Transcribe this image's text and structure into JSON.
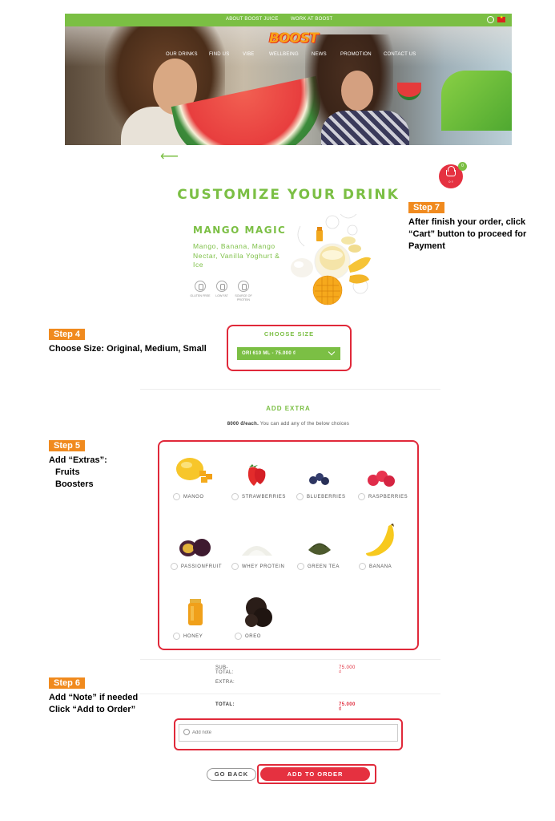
{
  "topbar": {
    "about": "ABOUT BOOST JUICE",
    "work": "WORK AT BOOST"
  },
  "logo": "BOOST",
  "nav": [
    "OUR DRINKS",
    "FIND US",
    "VIBE",
    "WELLBEING",
    "NEWS",
    "PROMOTION",
    "CONTACT US"
  ],
  "back_arrow": "⟵",
  "cart": {
    "count": "0",
    "amount": "0 ₫"
  },
  "page_title": "CUSTOMIZE YOUR DRINK",
  "product": {
    "name": "MANGO MAGIC",
    "description": "Mango, Banana, Mango Nectar, Vanilla Yoghurt & Ice",
    "badges": [
      {
        "label": "GLUTEN FREE",
        "icon": "gluten-free-icon"
      },
      {
        "label": "LOW FAT",
        "icon": "low-fat-icon"
      },
      {
        "label": "SOURCE OF PROTEIN",
        "icon": "protein-icon"
      }
    ]
  },
  "size": {
    "label": "CHOOSE SIZE",
    "selected": "ORI 610 ML - 75.000 ₫"
  },
  "extra": {
    "title": "ADD EXTRA",
    "price_bold": "8000 đ/each.",
    "price_rest": " You can add any of the below choices",
    "items": [
      {
        "label": "MANGO",
        "icon": "mango-icon"
      },
      {
        "label": "STRAWBERRIES",
        "icon": "strawberry-icon"
      },
      {
        "label": "BLUEBERRIES",
        "icon": "blueberry-icon"
      },
      {
        "label": "RASPBERRIES",
        "icon": "raspberry-icon"
      },
      {
        "label": "PASSIONFRUIT",
        "icon": "passionfruit-icon"
      },
      {
        "label": "WHEY PROTEIN",
        "icon": "whey-protein-icon"
      },
      {
        "label": "GREEN TEA",
        "icon": "green-tea-icon"
      },
      {
        "label": "BANANA",
        "icon": "banana-icon"
      },
      {
        "label": "HONEY",
        "icon": "honey-icon"
      },
      {
        "label": "OREO",
        "icon": "oreo-icon"
      }
    ]
  },
  "summary": {
    "subtotal_label": "SUB-TOTAL:",
    "subtotal_value": "75.000 ₫",
    "extra_label": "EXTRA:",
    "total_label": "TOTAL:",
    "total_value": "75.000 ₫"
  },
  "note": {
    "placeholder": "Add note"
  },
  "buttons": {
    "go_back": "GO BACK",
    "add_to_order": "ADD TO ORDER"
  },
  "steps": {
    "s4": {
      "tag": "Step 4",
      "lines": [
        "Choose Size: Original, Medium, Small"
      ]
    },
    "s5": {
      "tag": "Step 5",
      "lines": [
        "Add “Extras”:",
        "Fruits",
        "Boosters"
      ]
    },
    "s6": {
      "tag": "Step 6",
      "lines": [
        "Add “Note” if needed",
        "Click “Add to Order”"
      ]
    },
    "s7": {
      "tag": "Step 7",
      "lines": [
        "After finish your order, click",
        "“Cart” button to proceed for",
        "Payment"
      ]
    }
  },
  "colors": {
    "green": "#7bbf44",
    "red": "#e53140",
    "orange": "#f08a1e"
  }
}
